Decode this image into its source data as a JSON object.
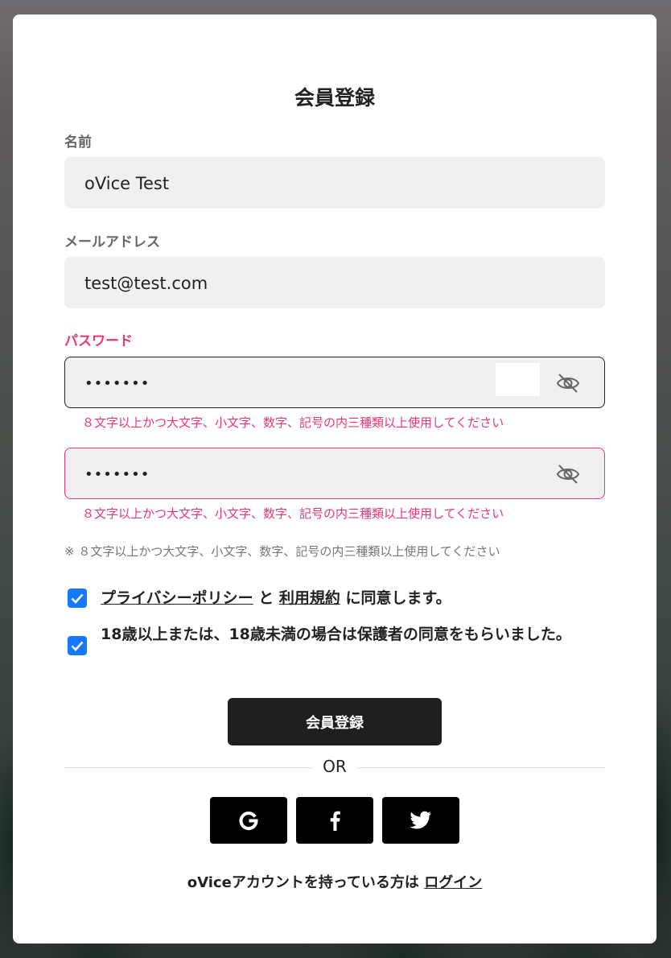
{
  "title": "会員登録",
  "name_field": {
    "label": "名前",
    "value": "oVice Test"
  },
  "email_field": {
    "label": "メールアドレス",
    "value": "test@test.com"
  },
  "password_field": {
    "label": "パスワード",
    "value": "•••••••",
    "error": "８文字以上かつ大文字、小文字、数字、記号の内三種類以上使用してください"
  },
  "password_confirm_field": {
    "value": "•••••••",
    "error": "８文字以上かつ大文字、小文字、数字、記号の内三種類以上使用してください"
  },
  "password_note": "※ ８文字以上かつ大文字、小文字、数字、記号の内三種類以上使用してください",
  "agreements": {
    "privacy_link": "プライバシーポリシー",
    "and": " と ",
    "terms_link": "利用規約",
    "agree_suffix": " に同意します。",
    "privacy_checked": true,
    "age_text": "18歳以上または、18歳未満の場合は保護者の同意をもらいました。",
    "age_checked": true
  },
  "submit_label": "会員登録",
  "or_label": "OR",
  "social": [
    "google-icon",
    "facebook-icon",
    "twitter-icon"
  ],
  "footer": {
    "text": "oViceアカウントを持っている方は ",
    "login_link": "ログイン"
  },
  "colors": {
    "error": "#e8386f",
    "checkbox": "#1677ff",
    "button": "#1e1e1e"
  }
}
